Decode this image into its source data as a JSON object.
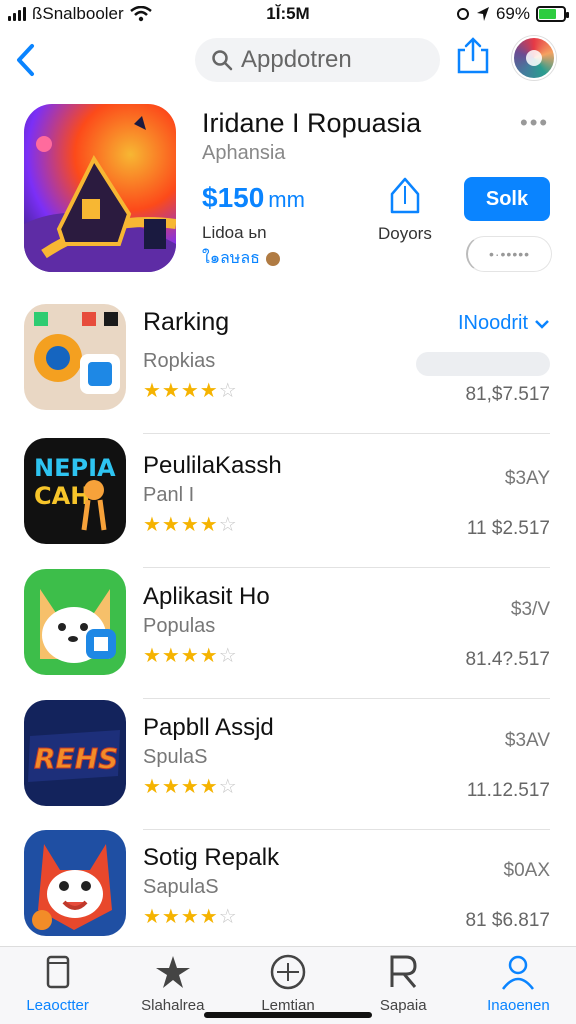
{
  "status": {
    "carrier": "ßSnalbooler",
    "time": "1Ĭ:5M",
    "battery_text": "69%",
    "battery_level": 0.69,
    "battery_color": "#2ecc40"
  },
  "nav": {
    "search_text": "Appdotren"
  },
  "featured": {
    "title": "Iridane I Ropuasia",
    "subtitle": "Aphansia",
    "price": "$150",
    "price_unit": "mm",
    "download_label": "Doyors",
    "get_label": "Solk",
    "meta": "Lidoa ьn",
    "link": "ใ๑ลษลธ",
    "toggle_text": "•·•••••"
  },
  "ranking": {
    "title": "Rarking",
    "link": "INoodrit"
  },
  "apps": [
    {
      "name": "",
      "category": "Ropkias",
      "rating": 4,
      "price_top": "",
      "price_bottom": "81,$7.517"
    },
    {
      "name": "PeulilaKassh",
      "category": "Panl   I",
      "rating": 4,
      "price_top": "$3AY",
      "price_bottom": "11 $2.517"
    },
    {
      "name": "Aplikasit Ho",
      "category": "Populas",
      "rating": 4,
      "price_top": "$3/V",
      "price_bottom": "81.4?.517"
    },
    {
      "name": "Papbll Assjd",
      "category": "SpulaS",
      "rating": 4,
      "price_top": "$3AV",
      "price_bottom": "11.12.517"
    },
    {
      "name": "Sotig Repalk",
      "category": "SapulaS",
      "rating": 4,
      "price_top": "$0AX",
      "price_bottom": "81 $6.817"
    }
  ],
  "tabs": [
    {
      "label": "Leaoctter",
      "icon": "tablet-icon"
    },
    {
      "label": "Slahalrea",
      "icon": "star-icon"
    },
    {
      "label": "Lemtian",
      "icon": "compass-icon"
    },
    {
      "label": "Sapaia",
      "icon": "search-r-icon"
    },
    {
      "label": "Inaoenen",
      "icon": "person-icon"
    }
  ],
  "colors": {
    "accent": "#0a84ff",
    "star": "#f5b301"
  }
}
